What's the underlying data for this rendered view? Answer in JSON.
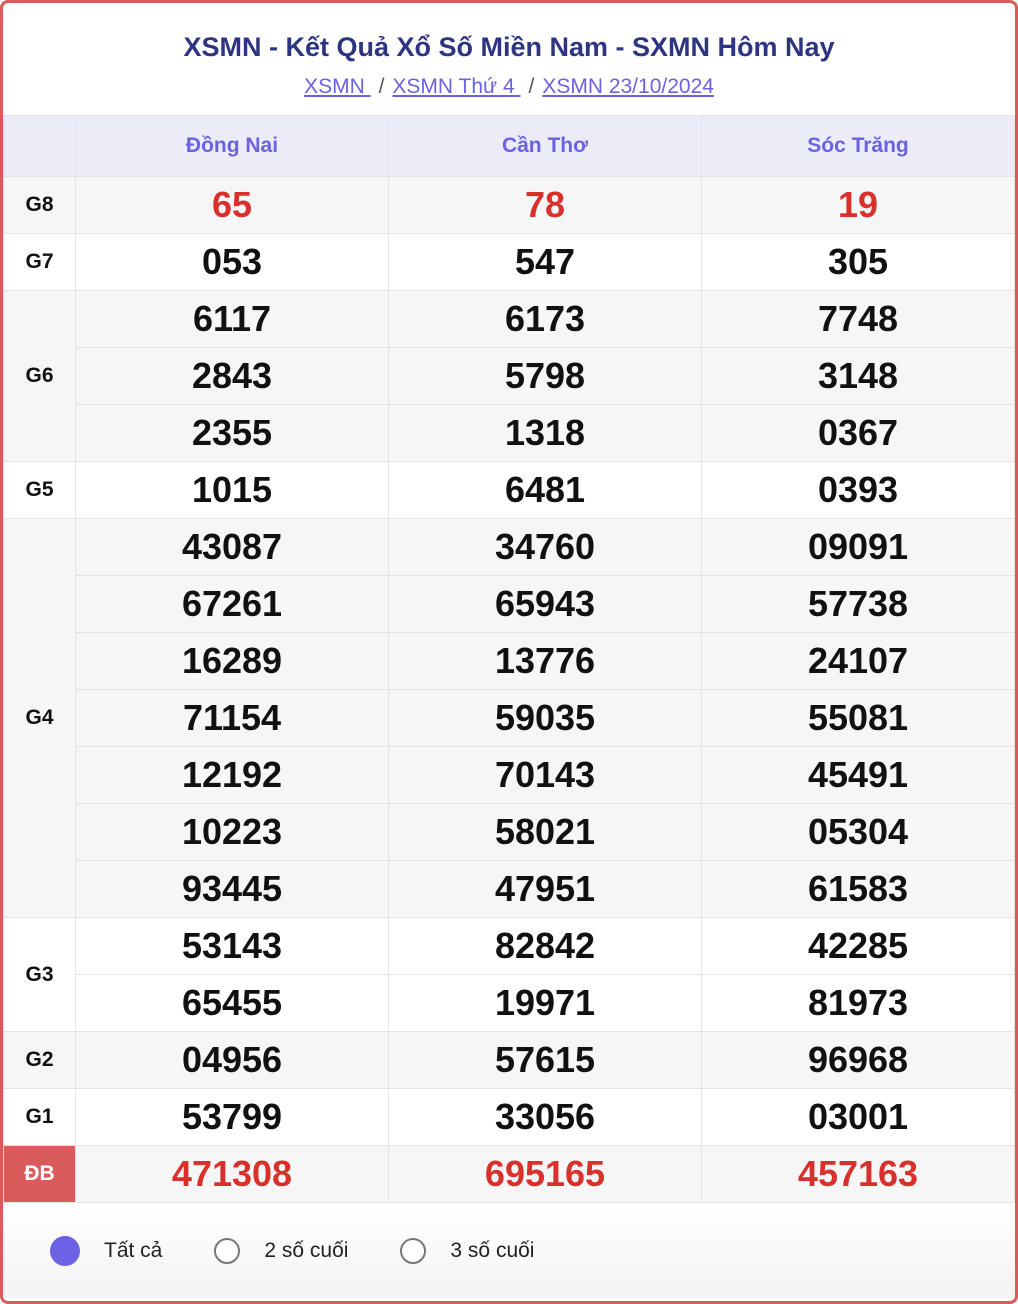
{
  "header": {
    "title": "XSMN - Kết Quả Xổ Số Miền Nam - SXMN Hôm Nay",
    "breadcrumb": [
      {
        "label": "XSMN "
      },
      {
        "label": "XSMN Thứ 4 "
      },
      {
        "label": "XSMN 23/10/2024"
      }
    ],
    "separator": "/"
  },
  "table": {
    "provinces": [
      "Đồng Nai",
      "Cần Thơ",
      "Sóc Trăng"
    ],
    "prizes": [
      {
        "label": "G8",
        "rows": [
          [
            "65",
            "78",
            "19"
          ]
        ],
        "highlight": true
      },
      {
        "label": "G7",
        "rows": [
          [
            "053",
            "547",
            "305"
          ]
        ]
      },
      {
        "label": "G6",
        "rows": [
          [
            "6117",
            "6173",
            "7748"
          ],
          [
            "2843",
            "5798",
            "3148"
          ],
          [
            "2355",
            "1318",
            "0367"
          ]
        ]
      },
      {
        "label": "G5",
        "rows": [
          [
            "1015",
            "6481",
            "0393"
          ]
        ]
      },
      {
        "label": "G4",
        "rows": [
          [
            "43087",
            "34760",
            "09091"
          ],
          [
            "67261",
            "65943",
            "57738"
          ],
          [
            "16289",
            "13776",
            "24107"
          ],
          [
            "71154",
            "59035",
            "55081"
          ],
          [
            "12192",
            "70143",
            "45491"
          ],
          [
            "10223",
            "58021",
            "05304"
          ],
          [
            "93445",
            "47951",
            "61583"
          ]
        ]
      },
      {
        "label": "G3",
        "rows": [
          [
            "53143",
            "82842",
            "42285"
          ],
          [
            "65455",
            "19971",
            "81973"
          ]
        ]
      },
      {
        "label": "G2",
        "rows": [
          [
            "04956",
            "57615",
            "96968"
          ]
        ]
      },
      {
        "label": "G1",
        "rows": [
          [
            "53799",
            "33056",
            "03001"
          ]
        ]
      },
      {
        "label": "ĐB",
        "rows": [
          [
            "471308",
            "695165",
            "457163"
          ]
        ],
        "highlight": true,
        "special": true
      }
    ]
  },
  "filter": {
    "options": [
      {
        "label": "Tất cả",
        "checked": true
      },
      {
        "label": "2 số cuối",
        "checked": false
      },
      {
        "label": "3 số cuối",
        "checked": false
      }
    ]
  },
  "colors": {
    "accent": "#6c62e0",
    "title": "#2d3582",
    "highlight_number": "#d9302c",
    "border": "#d95b5b"
  }
}
